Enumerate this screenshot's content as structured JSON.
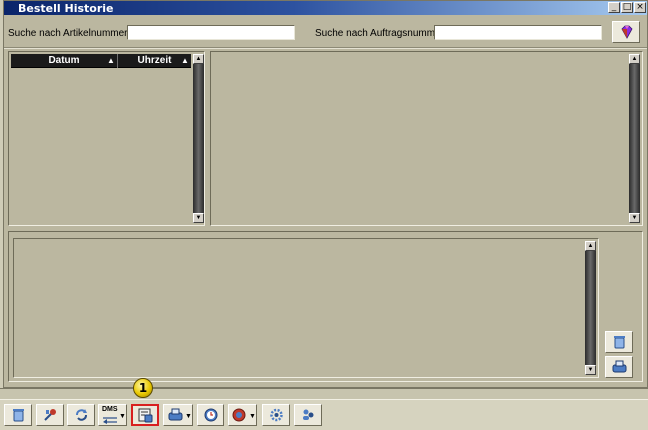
{
  "window": {
    "title": "Bestell Historie",
    "controls": {
      "minimize": "_",
      "maximize": "□",
      "close": "×"
    }
  },
  "search": {
    "article_label": "Suche nach Artikelnummer:",
    "article_value": "",
    "order_label": "Suche nach Auftragsnummer",
    "order_value": ""
  },
  "history_list": {
    "columns": [
      {
        "label": "Datum",
        "sort": "▲"
      },
      {
        "label": "Uhrzeit",
        "sort": "▲"
      }
    ],
    "rows": []
  },
  "scroll": {
    "up": "▲",
    "down": "▼"
  },
  "toolbar": {
    "dms_label": "DMS",
    "dropdown_caret": "▼",
    "step_marker": "1",
    "colors": {
      "highlight_border": "#d81f1f",
      "marker": "#e9c800"
    }
  }
}
